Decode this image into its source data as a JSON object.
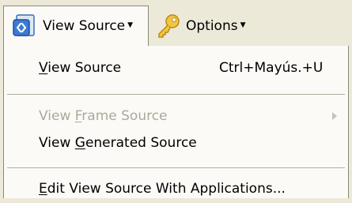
{
  "toolbar": {
    "view_source": {
      "label": "View Source",
      "icon": "view-source-icon"
    },
    "options": {
      "label": "Options",
      "icon": "key-icon"
    }
  },
  "menu": {
    "items": [
      {
        "parts": [
          "",
          "V",
          "iew Source"
        ],
        "shortcut": "Ctrl+Mayús.+U",
        "enabled": true
      },
      {
        "parts": [
          "View ",
          "F",
          "rame Source"
        ],
        "enabled": false,
        "submenu": true
      },
      {
        "parts": [
          "View ",
          "G",
          "enerated Source"
        ],
        "enabled": true
      },
      {
        "parts": [
          "",
          "E",
          "dit View Source With Applications..."
        ],
        "enabled": true
      }
    ]
  }
}
